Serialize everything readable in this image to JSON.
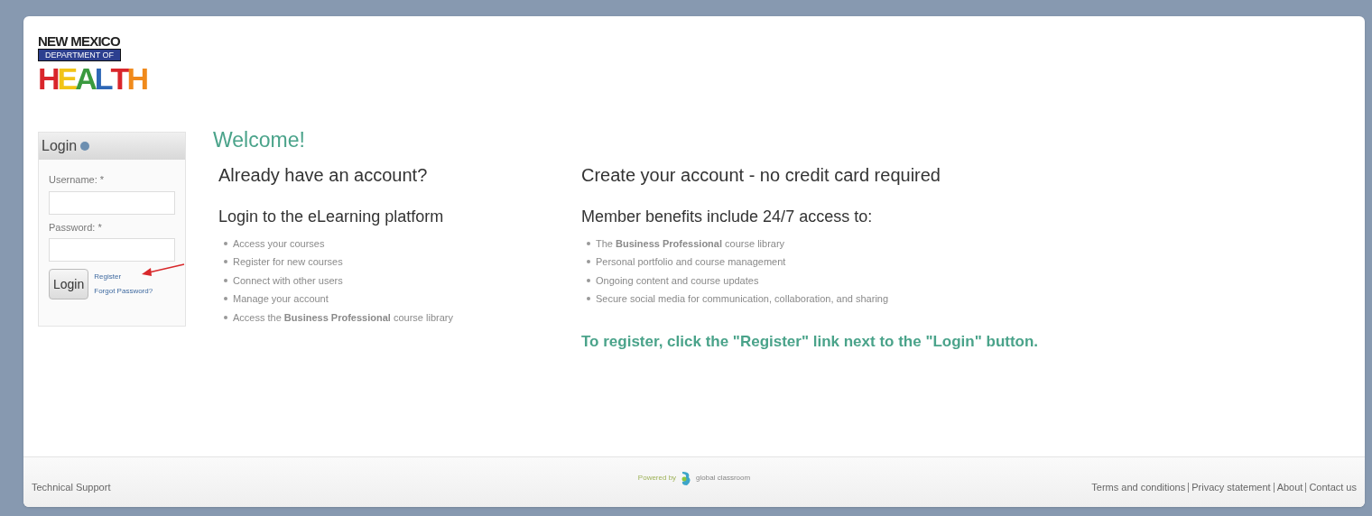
{
  "logo": {
    "top": "NEW MEXICO",
    "band": "DEPARTMENT OF",
    "letters": [
      {
        "char": "H",
        "color": "#d9262b"
      },
      {
        "char": "E",
        "color": "#f2c416"
      },
      {
        "char": "A",
        "color": "#3a9a3f"
      },
      {
        "char": "L",
        "color": "#2d67b6"
      },
      {
        "char": "T",
        "color": "#d9262b"
      },
      {
        "char": "H",
        "color": "#f08a1c"
      }
    ]
  },
  "login": {
    "title": "Login",
    "fields": [
      {
        "label": "Username: *"
      },
      {
        "label": "Password: *"
      }
    ],
    "button": "Login",
    "links": [
      "Register",
      "Forgot Password?"
    ]
  },
  "welcome": "Welcome!",
  "columns": [
    {
      "heading": "Already have an account?",
      "subheading": "Login to the eLearning platform",
      "items": [
        "Access your courses",
        "Register for new courses",
        "Connect with other users",
        "Manage your account",
        "Access the **Business Professional** course library"
      ]
    },
    {
      "heading": "Create your account - no credit card required",
      "subheading": "Member benefits include 24/7 access to:",
      "items": [
        "The **Business Professional** course library",
        "Personal portfolio and course management",
        "Ongoing content and course updates",
        "Secure social media for communication, collaboration, and sharing"
      ],
      "note": "To register, click the \"Register\" link next to the \"Login\" button."
    }
  ],
  "footer": {
    "left": "Technical Support",
    "powered": "Powered by",
    "brand": "global classroom",
    "links": [
      "Terms and conditions",
      "Privacy statement",
      "About",
      "Contact us"
    ]
  }
}
